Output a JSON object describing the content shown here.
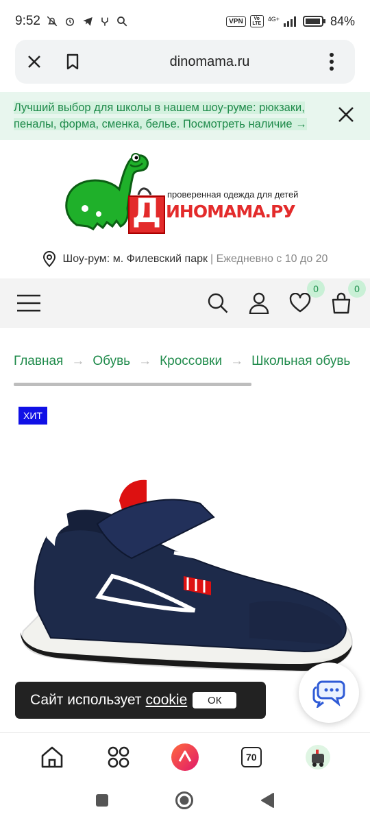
{
  "status_bar": {
    "time": "9:52",
    "vpn": "VPN",
    "volte": "Vo LTE",
    "network": "4G+",
    "battery": "84%"
  },
  "browser": {
    "url": "dinomama.ru"
  },
  "promo": {
    "text": "Лучший выбор для школы в нашем шоу-руме: рюкзаки, пеналы, форма, сменка, белье. Посмотреть наличие →"
  },
  "logo": {
    "tagline": "проверенная одежда для детей",
    "brand_letter": "Д",
    "brand_rest": "иномама.ру"
  },
  "showroom": {
    "location": "Шоу-рум: м. Филевский парк",
    "hours": "| Ежедневно с 10 до 20"
  },
  "header": {
    "wishlist_count": "0",
    "cart_count": "0"
  },
  "breadcrumbs": [
    "Главная",
    "Обувь",
    "Кроссовки",
    "Школьная обувь"
  ],
  "breadcrumb_separator": "→",
  "product": {
    "badge": "ХИТ"
  },
  "cookie": {
    "text": "Сайт использует",
    "link": "cookie",
    "ok": "ОК"
  },
  "bottom_nav": {
    "tabs_count": "70"
  },
  "colors": {
    "brand_green": "#1e8a4a",
    "promo_bg": "#e8f6ee",
    "badge_blue": "#1010e6",
    "logo_red": "#e32b2b"
  }
}
